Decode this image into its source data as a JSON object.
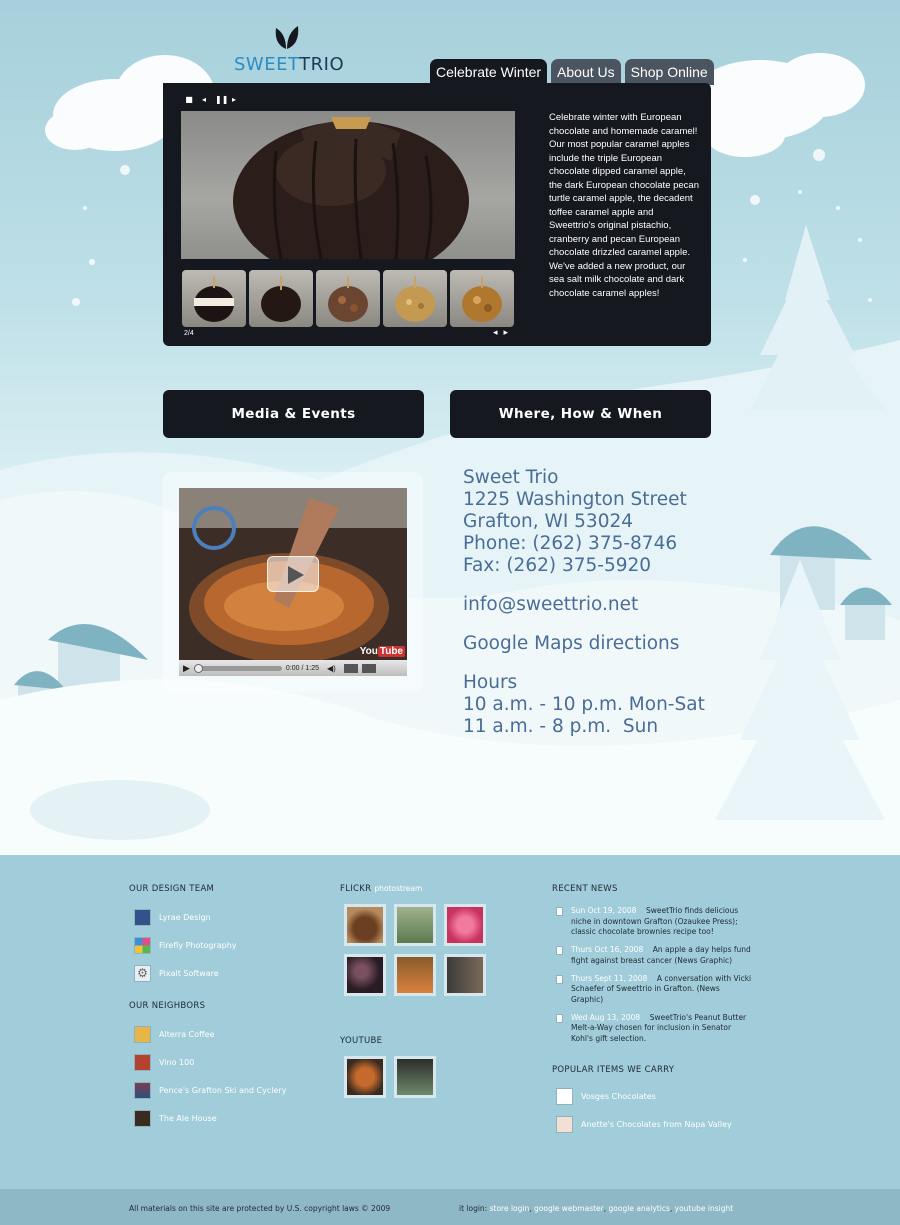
{
  "brand": {
    "logo_prefix": "SWEET",
    "logo_suffix": "TRIO"
  },
  "tabs": [
    {
      "label": "Celebrate Winter",
      "active": true
    },
    {
      "label": "About Us",
      "active": false
    },
    {
      "label": "Shop Online",
      "active": false
    }
  ],
  "feature": {
    "controls": [
      "stop-icon",
      "previous-icon",
      "pause-icon",
      "next-icon"
    ],
    "counter": "2/4",
    "text": "Celebrate winter with European chocolate and homemade caramel! Our most popular caramel apples include the triple European chocolate dipped caramel apple, the dark European chocolate pecan turtle caramel apple, the decadent toffee caramel apple and Sweettrio's original pistachio, cranberry and pecan European chocolate drizzled caramel apple. We've added a new product, our sea salt milk chocolate and dark chocolate caramel apples!",
    "thumbnails": [
      "white-chocolate-apple",
      "dark-chocolate-apple",
      "pecan-turtle-apple",
      "toffee-apple",
      "nut-apple"
    ]
  },
  "sections": {
    "media_events": "Media & Events",
    "where_how_when": "Where, How & When"
  },
  "video": {
    "time": "0:00 / 1:25",
    "badge_you": "You",
    "badge_tube": "Tube"
  },
  "contact": {
    "name": "Sweet Trio",
    "street": "1225 Washington Street",
    "city": "Grafton, WI 53024",
    "phone": "Phone: (262) 375-8746",
    "fax": "Fax: (262) 375-5920",
    "email": "info@sweettrio.net",
    "maps": "Google Maps directions",
    "hours_title": "Hours",
    "hours_weekday": "10 a.m. - 10 p.m. Mon-Sat",
    "hours_sunday": "11 a.m. - 8 p.m.  Sun"
  },
  "footer": {
    "design_team_title": "OUR DESIGN TEAM",
    "design_team": [
      "Lyrae Design",
      "Firefly Photography",
      "Pixalt Software"
    ],
    "neighbors_title": "OUR NEIGHBORS",
    "neighbors": [
      "Alterra Coffee",
      "Vino 100",
      "Pence's Grafton Ski and Cyclery",
      "The Ale House"
    ],
    "flickr_title": "FLICKR",
    "flickr_sub": "photostream",
    "youtube_title": "YOUTUBE",
    "news_title": "RECENT NEWS",
    "news": [
      {
        "date": "Sun Oct 19, 2008",
        "text": "SweetTrio finds delicious niche in downtown Grafton (Ozaukee Press); classic chocolate brownies recipe too!"
      },
      {
        "date": "Thurs Oct 16, 2008",
        "text": "An apple a day helps fund fight against breast cancer (News Graphic)"
      },
      {
        "date": "Thurs Sept 11, 2008",
        "text": "A conversation with Vicki Schaefer of Sweettrio in Grafton. (News Graphic)"
      },
      {
        "date": "Wed Aug 13, 2008",
        "text": "SweetTrio's Peanut Butter Melt-a-Way chosen for inclusion in Senator Kohl's gift selection."
      }
    ],
    "popular_title": "POPULAR ITEMS WE CARRY",
    "popular": [
      "Vosges Chocolates",
      "Anette's Chocolates from Napa Valley"
    ]
  },
  "bottom": {
    "copyright": "All materials on this site are protected by U.S. copyright laws © 2009",
    "login_prefix": "it login:",
    "links": [
      "store login",
      "google webmaster",
      "google analytics",
      "youtube insight"
    ]
  },
  "colors": {
    "panel": "#15181f",
    "accent": "#4a6d98",
    "footer": "#a1ccd9"
  }
}
